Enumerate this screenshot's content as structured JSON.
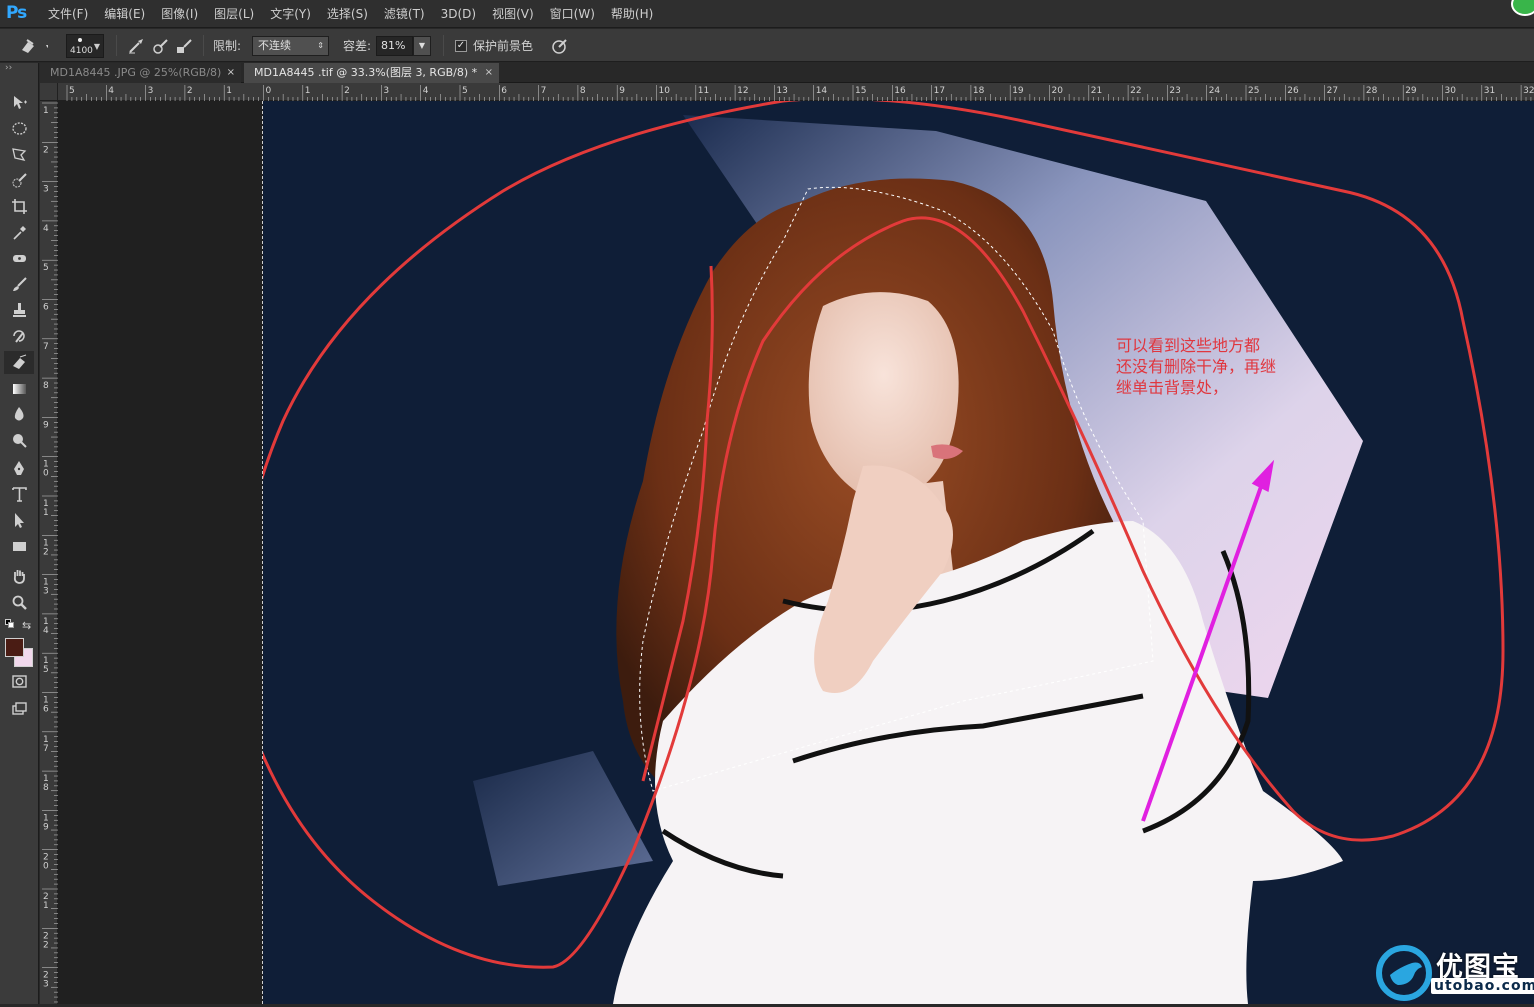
{
  "app": {
    "logo": "Ps",
    "brand_color": "#31a8ff"
  },
  "menu": [
    "文件(F)",
    "编辑(E)",
    "图像(I)",
    "图层(L)",
    "文字(Y)",
    "选择(S)",
    "滤镜(T)",
    "3D(D)",
    "视图(V)",
    "窗口(W)",
    "帮助(H)"
  ],
  "options": {
    "brush_size": "4100",
    "limit_label": "限制:",
    "limit_value": "不连续",
    "tolerance_label": "容差:",
    "tolerance_value": "81%",
    "protect_fg_checked": true,
    "protect_fg_label": "保护前景色"
  },
  "tabs": [
    {
      "title": "MD1A8445 .JPG @ 25%(RGB/8)",
      "close": "×",
      "active": false
    },
    {
      "title": "MD1A8445 .tif @ 33.3%(图层 3, RGB/8) *",
      "close": "×",
      "active": true
    }
  ],
  "tools": [
    "move-icon",
    "elliptical-marquee-icon",
    "polygonal-lasso-icon",
    "quick-selection-icon",
    "crop-icon",
    "eyedropper-icon",
    "healing-brush-icon",
    "brush-icon",
    "clone-stamp-icon",
    "history-brush-icon",
    "background-eraser-icon",
    "gradient-icon",
    "blur-icon",
    "dodge-icon",
    "pen-icon",
    "type-icon",
    "path-selection-icon",
    "rectangle-icon",
    "hand-icon",
    "zoom-icon",
    "swap-colors-icon",
    "foreground-color-swatch",
    "quick-mask-icon",
    "screen-mode-icon"
  ],
  "colors": {
    "foreground": "#4a1c14",
    "background": "#f1d8ec",
    "canvas_bg": "#0f1e37",
    "annotation": "#e0373f",
    "arrow": "#e020e0"
  },
  "ruler": {
    "h_ticks": [
      "5",
      "4",
      "3",
      "2",
      "1",
      "0",
      "1",
      "2",
      "3",
      "4",
      "5",
      "6",
      "7",
      "8",
      "9",
      "10",
      "11",
      "12",
      "13",
      "14",
      "15",
      "16",
      "17",
      "18",
      "19",
      "20",
      "21",
      "22",
      "23",
      "24",
      "25",
      "26",
      "27",
      "28",
      "29",
      "30",
      "31",
      "32"
    ],
    "v_ticks": [
      "1",
      "2",
      "3",
      "4",
      "5",
      "6",
      "7",
      "8",
      "9",
      "10",
      "11",
      "12",
      "13",
      "14",
      "15",
      "16",
      "17",
      "18",
      "19",
      "20",
      "21",
      "22",
      "23"
    ]
  },
  "annotation": {
    "lines": [
      "可以看到这些地方都",
      "还没有删除干净，再继",
      "继单击背景处，"
    ]
  },
  "watermark": {
    "cn": "优图宝",
    "en": "utobao.com"
  }
}
